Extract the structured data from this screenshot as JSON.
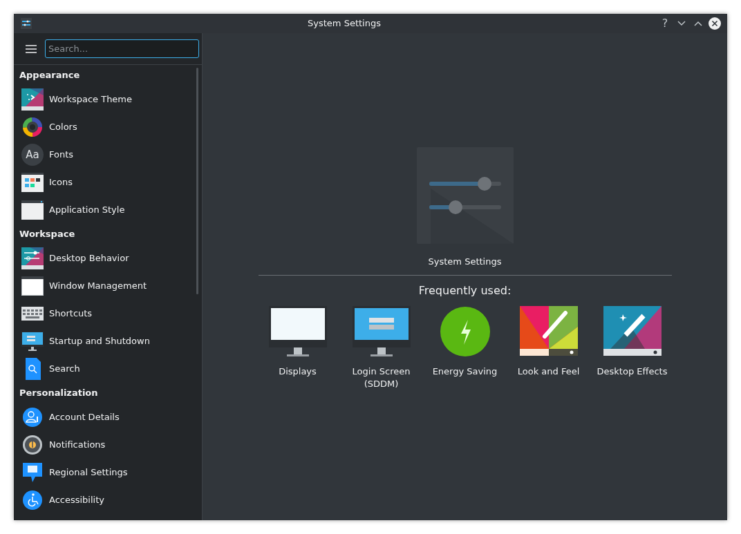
{
  "window": {
    "title": "System Settings",
    "buttons": [
      "?"
    ]
  },
  "search": {
    "placeholder": "Search..."
  },
  "sidebar": {
    "groups": [
      {
        "title": "Appearance",
        "items": [
          {
            "label": "Workspace Theme"
          },
          {
            "label": "Colors"
          },
          {
            "label": "Fonts",
            "icon_text": "Aa"
          },
          {
            "label": "Icons"
          },
          {
            "label": "Application Style"
          }
        ]
      },
      {
        "title": "Workspace",
        "items": [
          {
            "label": "Desktop Behavior"
          },
          {
            "label": "Window Management"
          },
          {
            "label": "Shortcuts"
          },
          {
            "label": "Startup and Shutdown"
          },
          {
            "label": "Search"
          }
        ]
      },
      {
        "title": "Personalization",
        "items": [
          {
            "label": "Account Details"
          },
          {
            "label": "Notifications"
          },
          {
            "label": "Regional Settings"
          },
          {
            "label": "Accessibility"
          }
        ]
      }
    ]
  },
  "main": {
    "title": "System Settings",
    "frequent_heading": "Frequently used:",
    "frequent": [
      {
        "label": "Displays"
      },
      {
        "label": "Login Screen (SDDM)"
      },
      {
        "label": "Energy Saving"
      },
      {
        "label": "Look and Feel"
      },
      {
        "label": "Desktop Effects"
      }
    ]
  }
}
